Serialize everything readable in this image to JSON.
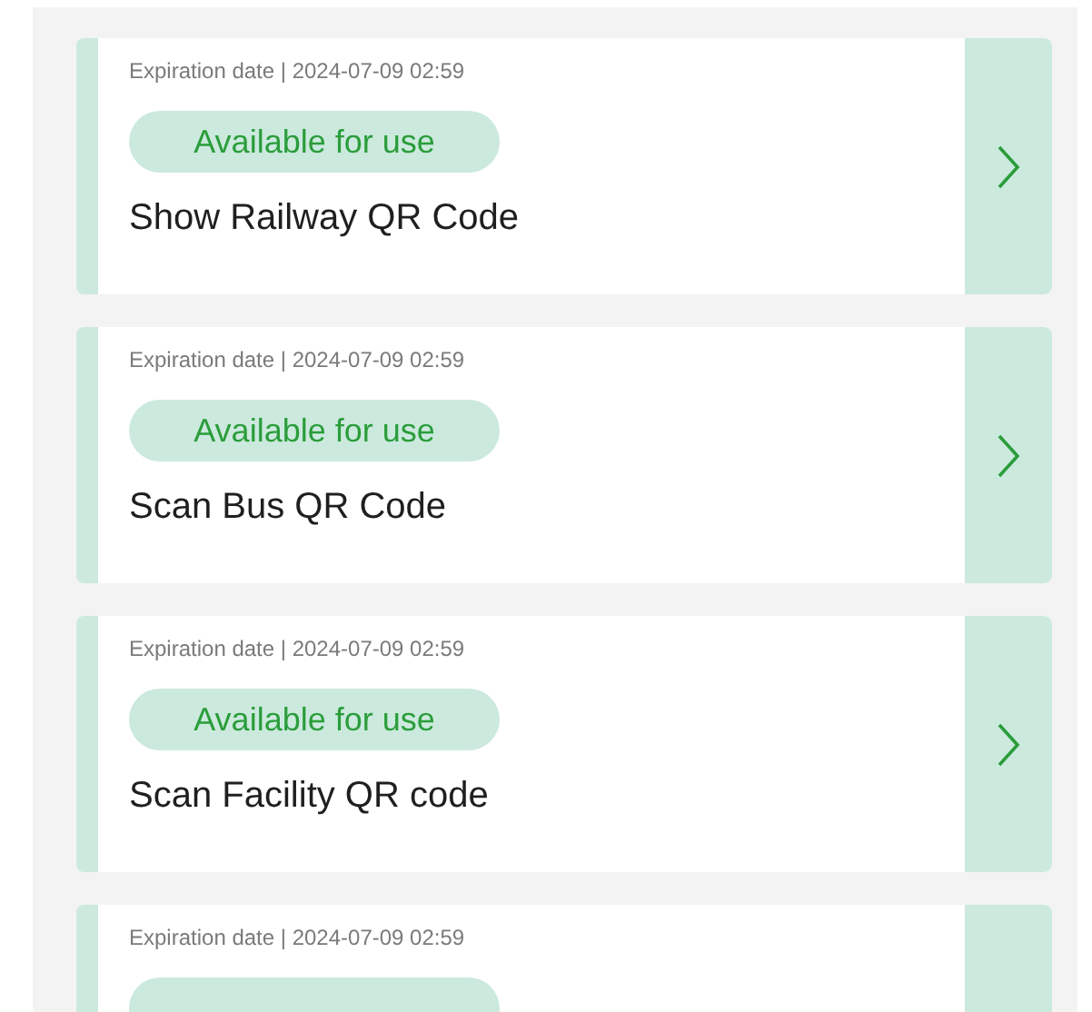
{
  "cards": [
    {
      "expiration": "Expiration date | 2024-07-09 02:59",
      "status": "Available for use",
      "title": "Show Railway QR Code"
    },
    {
      "expiration": "Expiration date | 2024-07-09 02:59",
      "status": "Available for use",
      "title": "Scan Bus QR Code"
    },
    {
      "expiration": "Expiration date | 2024-07-09 02:59",
      "status": "Available for use",
      "title": "Scan Facility QR code"
    },
    {
      "expiration": "Expiration date | 2024-07-09 02:59",
      "status_badge": true
    }
  ]
}
